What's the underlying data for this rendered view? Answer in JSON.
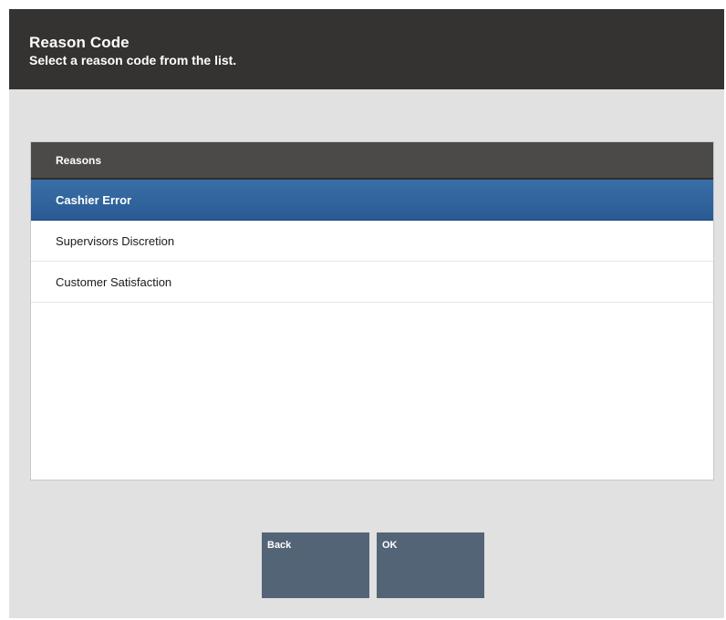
{
  "header": {
    "title": "Reason Code",
    "subtitle": "Select a reason code from the list."
  },
  "list": {
    "column_header": "Reasons",
    "items": [
      {
        "label": "Cashier Error",
        "selected": true
      },
      {
        "label": "Supervisors Discretion",
        "selected": false
      },
      {
        "label": "Customer Satisfaction",
        "selected": false
      }
    ]
  },
  "buttons": {
    "back_label": "Back",
    "ok_label": "OK"
  },
  "colors": {
    "header_bg": "#353331",
    "selected_row": "#2f64a0",
    "button_bg": "#536477",
    "dialog_bg": "#e1e1e1"
  }
}
